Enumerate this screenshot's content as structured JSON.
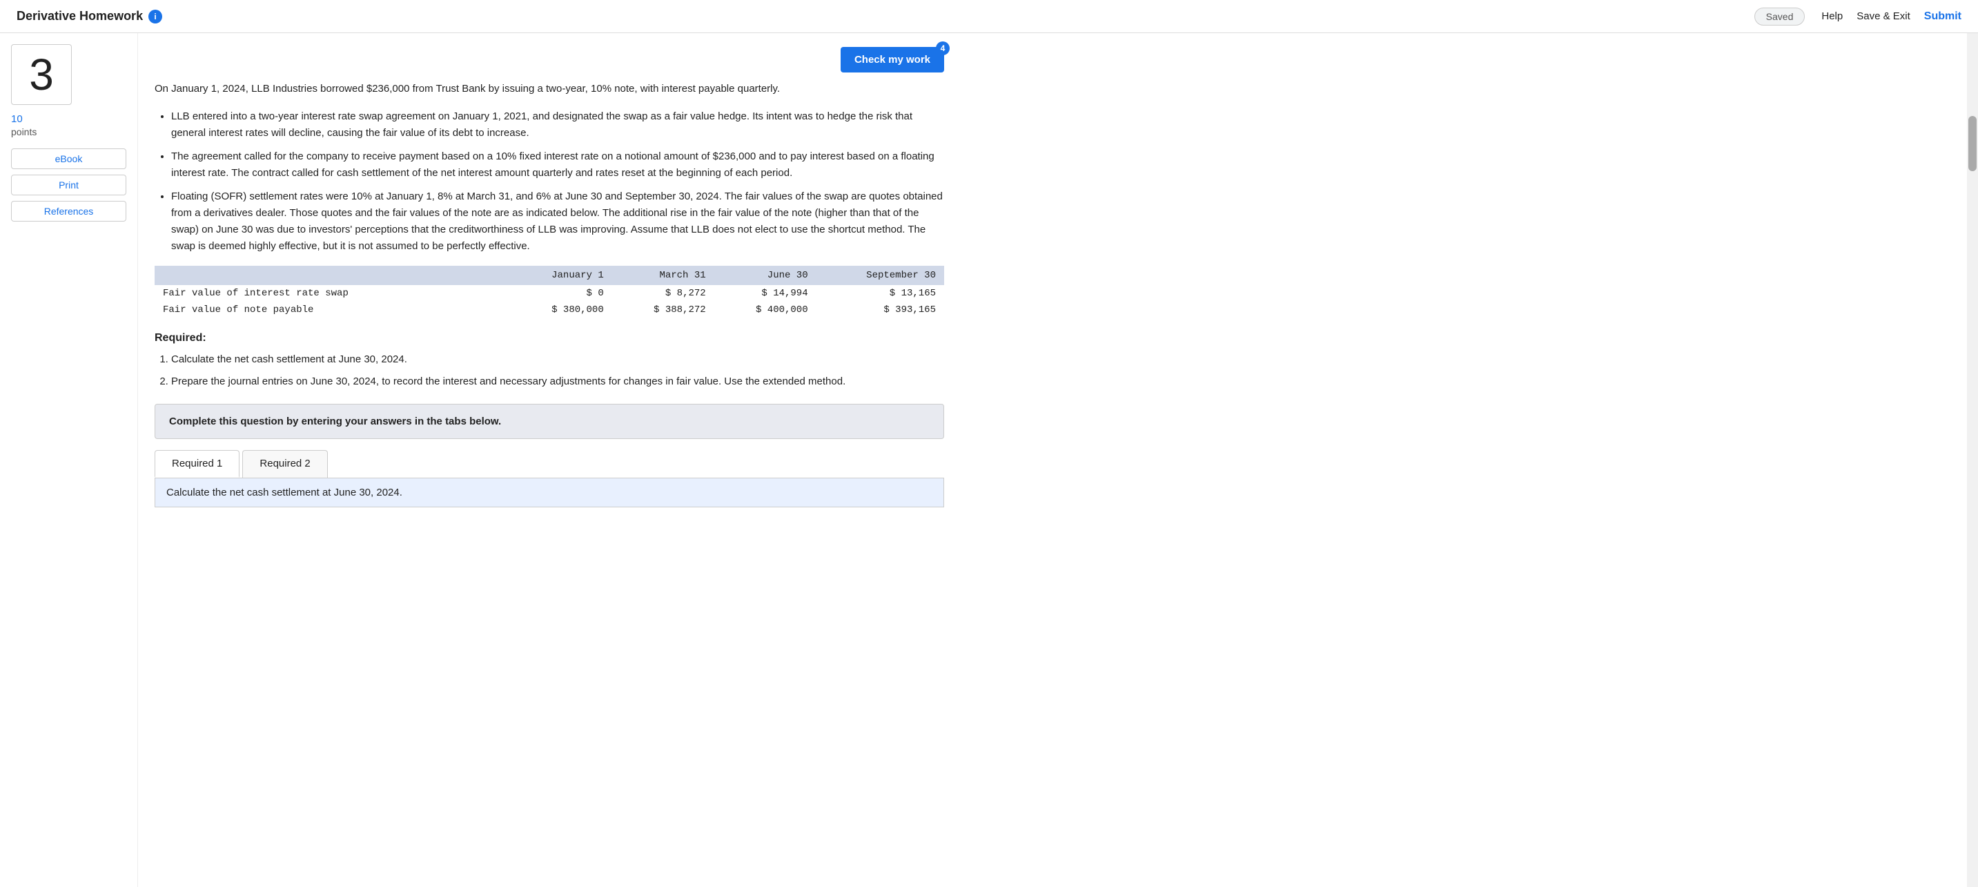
{
  "header": {
    "title": "Derivative Homework",
    "info_icon": "i",
    "saved_label": "Saved",
    "help_label": "Help",
    "save_exit_label": "Save & Exit",
    "submit_label": "Submit"
  },
  "sidebar": {
    "question_number": "3",
    "points_value": "10",
    "points_label": "points",
    "ebook_label": "eBook",
    "print_label": "Print",
    "references_label": "References"
  },
  "check_work": {
    "button_label": "Check my work",
    "badge": "4"
  },
  "question": {
    "intro": "On January 1, 2024, LLB Industries borrowed $236,000 from Trust Bank by issuing a two-year, 10% note, with interest payable quarterly.",
    "bullets": [
      "LLB entered into a two-year interest rate swap agreement on January 1, 2021, and designated the swap as a fair value hedge. Its intent was to hedge the risk that general interest rates will decline, causing the fair value of its debt to increase.",
      "The agreement called for the company to receive payment based on a 10% fixed interest rate on a notional amount of $236,000 and to pay interest based on a floating interest rate. The contract called for cash settlement of the net interest amount quarterly and rates reset at the beginning of each period.",
      "Floating (SOFR) settlement rates were 10% at January 1, 8% at March 31, and 6% at June 30 and September 30, 2024. The fair values of the swap are quotes obtained from a derivatives dealer. Those quotes and the fair values of the note are as indicated below. The additional rise in the fair value of the note (higher than that of the swap) on June 30 was due to investors' perceptions that the creditworthiness of LLB was improving. Assume that LLB does not elect to use the shortcut method. The swap is deemed highly effective, but it is not assumed to be perfectly effective."
    ],
    "table": {
      "headers": [
        "",
        "January 1",
        "March 31",
        "June 30",
        "September 30"
      ],
      "rows": [
        {
          "label": "Fair value of interest rate swap",
          "jan1": "$ 0",
          "mar31": "$ 8,272",
          "jun30": "$ 14,994",
          "sep30": "$ 13,165"
        },
        {
          "label": "Fair value of note payable",
          "jan1": "$ 380,000",
          "mar31": "$ 388,272",
          "jun30": "$ 400,000",
          "sep30": "$ 393,165"
        }
      ]
    },
    "required_heading": "Required:",
    "required_items": [
      "Calculate the net cash settlement at June 30, 2024.",
      "Prepare the journal entries on June 30, 2024, to record the interest and necessary adjustments for changes in fair value. Use the extended method."
    ],
    "complete_box_text": "Complete this question by entering your answers in the tabs below.",
    "tabs": [
      {
        "label": "Required 1",
        "active": true
      },
      {
        "label": "Required 2",
        "active": false
      }
    ],
    "tab_content": "Calculate the net cash settlement at June 30, 2024."
  }
}
